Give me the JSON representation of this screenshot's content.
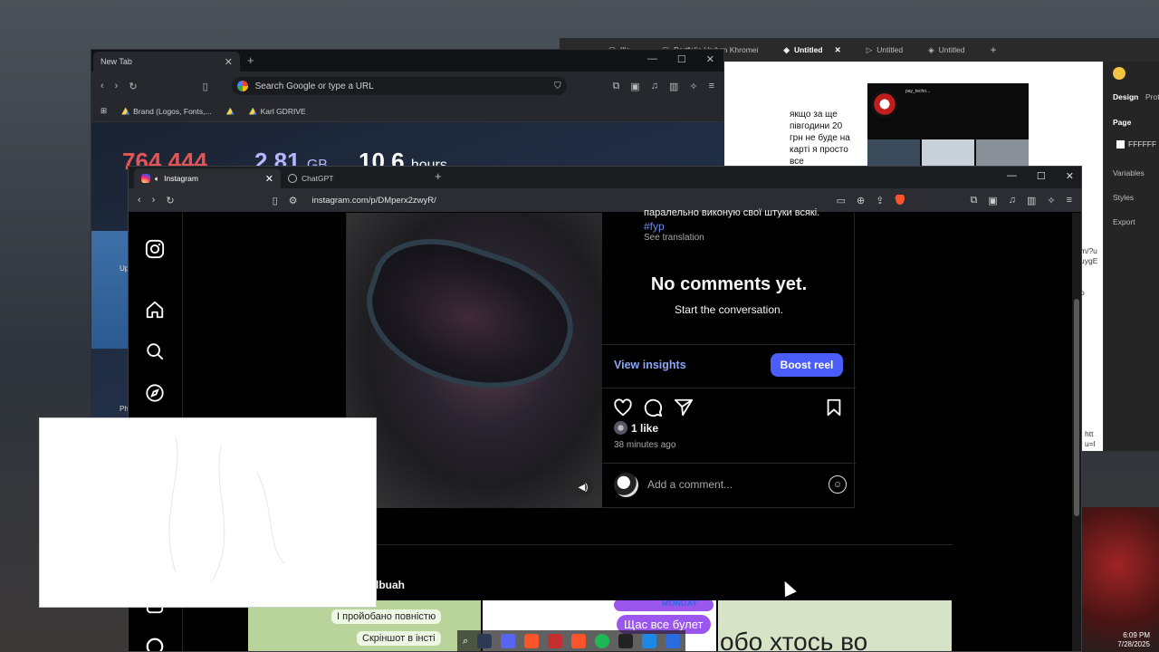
{
  "background_browser": {
    "tab_title": "New Tab",
    "omnibox_placeholder": "Search Google or type a URL",
    "bookmarks": [
      "Brand (Logos, Fonts,...",
      "Karl GDRIVE"
    ],
    "stats": [
      {
        "value": "764 444",
        "unit": ""
      },
      {
        "value": "2.81",
        "unit": "GB"
      },
      {
        "value": "10.6",
        "unit": "hours"
      }
    ],
    "side_labels": {
      "up": "Up",
      "ph": "Ph"
    }
  },
  "design_app": {
    "tabs": [
      {
        "label": "",
        "active": false
      },
      {
        "label": "Ille...",
        "active": false
      },
      {
        "label": "Portfolio Vadym Khromei",
        "active": false
      },
      {
        "label": "Untitled",
        "active": true
      },
      {
        "label": "Untitled",
        "active": false
      },
      {
        "label": "Untitled",
        "active": false
      }
    ],
    "note_text": "якщо за ще півгодини 20 грн не буде на карті я просто все",
    "thumb_name": "pay_techn...",
    "side_url_lines": [
      "m/?u",
      "uygE",
      "o"
    ],
    "side_url_bottom": [
      "htt",
      "u=l"
    ],
    "panel": {
      "design_tab": "Design",
      "proto_tab": "Prot",
      "page_label": "Page",
      "page_color": "FFFFFF",
      "variables": "Variables",
      "styles": "Styles",
      "export": "Export"
    }
  },
  "main_browser": {
    "tabs": [
      {
        "label": "Instagram",
        "active": true
      },
      {
        "label": "ChatGPT",
        "active": false
      }
    ],
    "url": "instagram.com/p/DMperx2zwyR/"
  },
  "instagram": {
    "caption_partial": "паралельно виконую свої штуки всякі.",
    "hashtag": "#fyp",
    "see_translation": "See translation",
    "no_comments_title": "No comments yet.",
    "no_comments_sub": "Start the conversation.",
    "view_insights": "View insights",
    "boost_reel": "Boost reel",
    "likes": "1 like",
    "time_ago": "38 minutes ago",
    "add_comment_placeholder": "Add a comment...",
    "more_from": "lbuah",
    "grid_texts": {
      "chat_line_1": "І пройобано повністю",
      "chat_line_2": "Скріншот в інсті",
      "pill_top": "MONDAY",
      "pill": "Щас все булет",
      "big": "обо хтось во"
    }
  },
  "system": {
    "time": "6:09 PM",
    "date": "7/28/2025"
  },
  "colors": {
    "ig_blue_link": "#8aa6f5",
    "boost_button": "#4a5df9",
    "hashtag": "#6b8ef0",
    "stat_1": "#e45454",
    "stat_2": "#b8b4ff",
    "stat_3": "#ffffff"
  }
}
